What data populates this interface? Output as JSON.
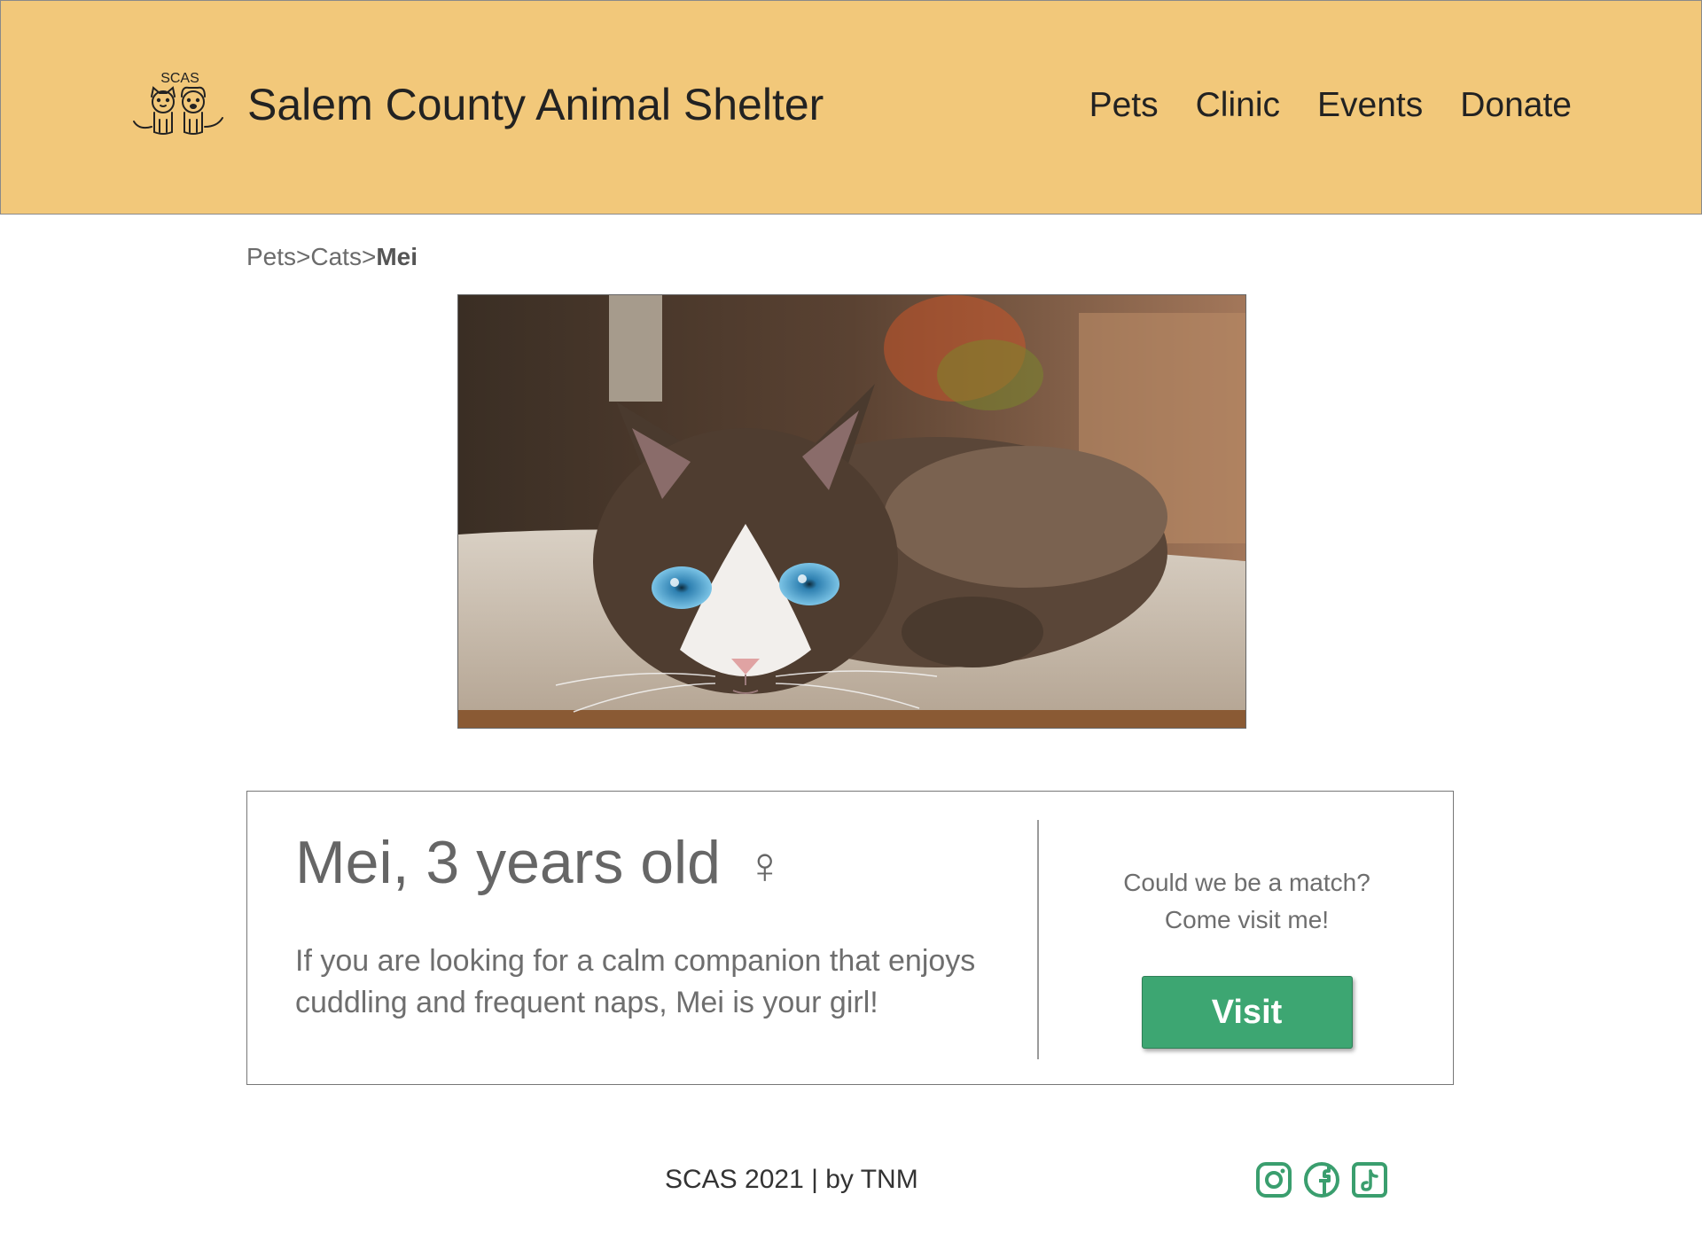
{
  "header": {
    "logo_text": "SCAS",
    "title": "Salem County Animal Shelter",
    "nav": [
      "Pets",
      "Clinic",
      "Events",
      "Donate"
    ]
  },
  "breadcrumb": {
    "items": [
      "Pets",
      "Cats"
    ],
    "separator": ">",
    "current": "Mei"
  },
  "photo": {
    "icon": "cat-photo"
  },
  "pet": {
    "heading": "Mei, 3 years old",
    "gender_symbol": "♀",
    "description": "If you are looking for a calm companion that enjoys cuddling and frequent naps, Mei is your girl!"
  },
  "cta": {
    "line1": "Could we be a match?",
    "line2": "Come visit me!",
    "button_label": "Visit"
  },
  "footer": {
    "text": "SCAS 2021 | by TNM",
    "socials": [
      "instagram-icon",
      "facebook-icon",
      "tiktok-icon"
    ]
  },
  "colors": {
    "header_bg": "#f2c87a",
    "accent_green": "#3da672",
    "social_green": "#3a9e6e",
    "text_gray": "#6e6e6e"
  }
}
